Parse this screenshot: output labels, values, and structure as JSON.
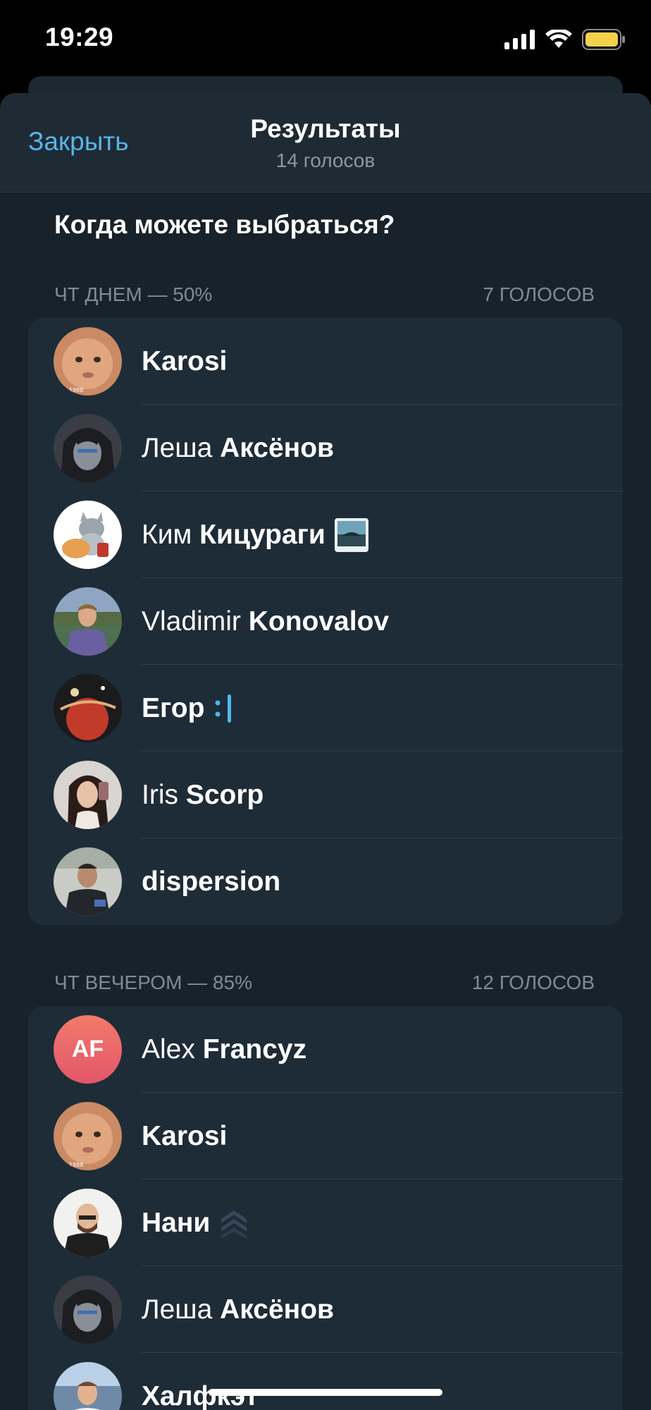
{
  "status": {
    "time": "19:29"
  },
  "nav": {
    "close_label": "Закрыть",
    "title": "Результаты",
    "subtitle": "14 голосов"
  },
  "question": "Когда можете выбраться?",
  "options": [
    {
      "label": "ЧТ ДНЕМ — 50%",
      "votes": "7 голосов",
      "voters": [
        {
          "first": "Karosi",
          "last": "",
          "avatar": "baby"
        },
        {
          "first": "Леша",
          "last": "Аксёнов",
          "avatar": "anime"
        },
        {
          "first": "Ким",
          "last": "Кицураги",
          "avatar": "cat",
          "status_icon": "landscape-image-icon"
        },
        {
          "first": "Vladimir",
          "last": "Konovalov",
          "avatar": "man-outdoor"
        },
        {
          "first": "Егор",
          "last": "",
          "avatar": "planet",
          "status_icon": "colon-bar-icon"
        },
        {
          "first": "Iris",
          "last": "Scorp",
          "avatar": "woman"
        },
        {
          "first": "dispersion",
          "last": "",
          "avatar": "man-dark"
        }
      ]
    },
    {
      "label": "ЧТ ВЕЧЕРОМ — 85%",
      "votes": "12 голосов",
      "voters": [
        {
          "first": "Alex",
          "last": "Francyz",
          "avatar": "initials",
          "initials": "AF"
        },
        {
          "first": "Karosi",
          "last": "",
          "avatar": "baby"
        },
        {
          "first": "Нани",
          "last": "",
          "avatar": "bald-man",
          "status_icon": "stack-chevron-icon"
        },
        {
          "first": "Леша",
          "last": "Аксёнов",
          "avatar": "anime"
        },
        {
          "first": "Халфкэт",
          "last": "",
          "avatar": "office"
        }
      ]
    }
  ],
  "colors": {
    "accent": "#5ab3e8",
    "sheet": "#18222a",
    "card": "#1e2c37"
  }
}
